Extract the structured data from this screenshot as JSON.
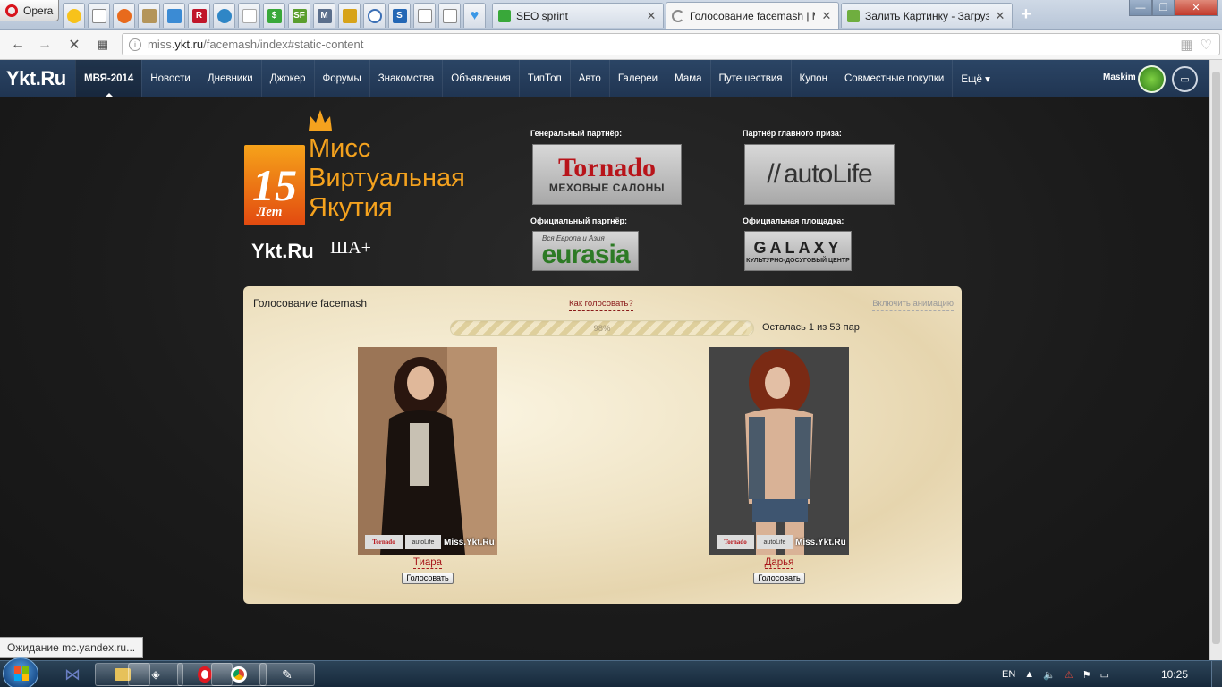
{
  "browser": {
    "menu_label": "Opera",
    "tabs": [
      {
        "title": "SEO sprint",
        "close": "✕"
      },
      {
        "title": "Голосование facemash | Miss.Ykt.Ru",
        "close": "✕"
      },
      {
        "title": "Залить Картинку - Загрузить фото",
        "close": "✕"
      }
    ],
    "new_tab": "+",
    "window_controls": {
      "minimize": "—",
      "maximize": "❐",
      "close": "✕"
    },
    "url_prefix": "miss.",
    "url_host": "ykt.ru",
    "url_path": "/facemash/index#static-content",
    "status_text": "Ожидание mc.yandex.ru..."
  },
  "site": {
    "logo": "Ykt.Ru",
    "menu": [
      "МВЯ-2014",
      "Новости",
      "Дневники",
      "Джокер",
      "Форумы",
      "Знакомства",
      "Объявления",
      "ТипТоп",
      "Авто",
      "Галереи",
      "Мама",
      "Путешествия",
      "Купон",
      "Совместные покупки",
      "Ещё ▾"
    ],
    "user_name": "Maskim"
  },
  "contest": {
    "years": "15",
    "years_word": "Лет",
    "title": "Мисс Виртуальная Якутия",
    "ykt_logo": "Ykt.Ru",
    "partner_logo": "ША+"
  },
  "partners": {
    "general_label": "Генеральный партнёр:",
    "general_name": "Tornado",
    "general_sub": "МЕХОВЫЕ САЛОНЫ",
    "prize_label": "Партнёр главного приза:",
    "prize_name": "autoLife",
    "official_label": "Официальный партнёр:",
    "official_sub": "Вся Европа и Азия",
    "official_name": "eurasia",
    "venue_label": "Официальная площадка:",
    "venue_name": "GALAXY",
    "venue_sub": "КУЛЬТУРНО-ДОСУГОВЫЙ ЦЕНТР"
  },
  "vote": {
    "title": "Голосование facemash",
    "how_to": "Как голосовать?",
    "animation_toggle": "Включить анимацию",
    "progress_value": 0.98,
    "progress_label": "98%",
    "remaining": "Осталась 1 из 53 пар",
    "candidates": [
      {
        "name": "Тиара",
        "button": "Голосовать",
        "watermark": "Miss.Ykt.Ru",
        "stamp_tornado": "Tornado",
        "stamp_autolife": "autoLife"
      },
      {
        "name": "Дарья",
        "button": "Голосовать",
        "watermark": "Miss.Ykt.Ru",
        "stamp_tornado": "Tornado",
        "stamp_autolife": "autoLife"
      }
    ]
  },
  "taskbar": {
    "language": "EN",
    "time": "10:25"
  }
}
